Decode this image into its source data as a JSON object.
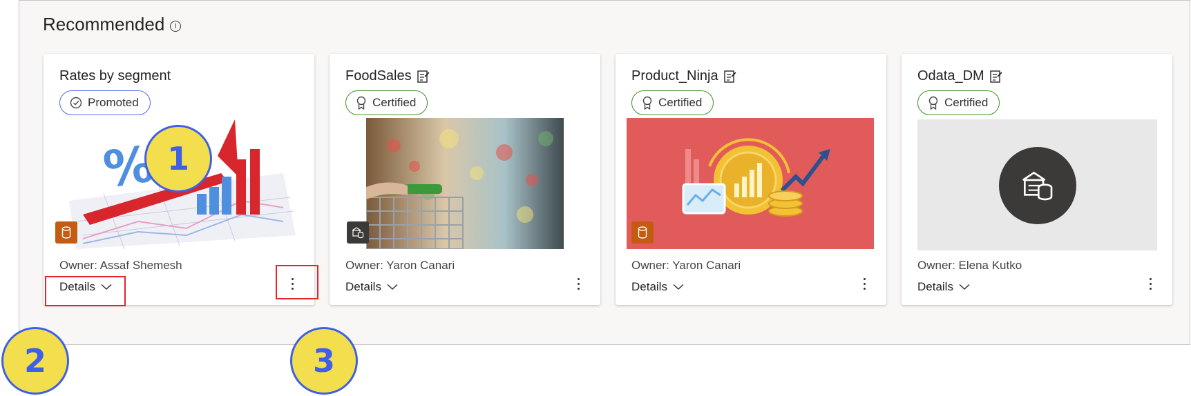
{
  "section": {
    "title": "Recommended",
    "info_icon": "info-icon"
  },
  "cards": [
    {
      "title": "Rates by segment",
      "badge": "Promoted",
      "owner": "Owner: Assaf Shemesh",
      "details": "Details",
      "type_icon": "dataset-cylinder-icon"
    },
    {
      "title": "FoodSales",
      "badge": "Certified",
      "owner": "Owner: Yaron Canari",
      "details": "Details",
      "type_icon": "datamart-icon"
    },
    {
      "title": "Product_Ninja",
      "badge": "Certified",
      "owner": "Owner: Yaron Canari",
      "details": "Details",
      "type_icon": "dataset-cylinder-icon"
    },
    {
      "title": "Odata_DM",
      "badge": "Certified",
      "owner": "Owner: Elena Kutko",
      "details": "Details",
      "type_icon": "datamart-icon"
    }
  ],
  "callouts": [
    "1",
    "2",
    "3"
  ],
  "colors": {
    "promoted_border": "#4f6bed",
    "certified_border": "#3f8f2b",
    "callout_fill": "#f3df4d",
    "callout_text": "#3f5fe6",
    "highlight": "#e3242b",
    "type_tile": "#c55a11"
  }
}
